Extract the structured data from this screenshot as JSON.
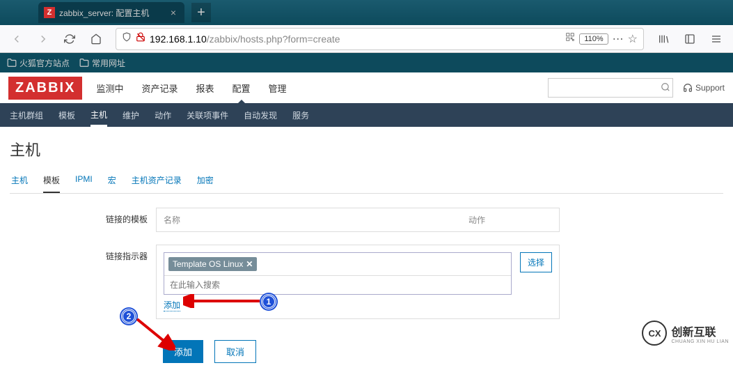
{
  "browser": {
    "tab": {
      "favicon_letter": "Z",
      "title": "zabbix_server: 配置主机"
    },
    "url": {
      "host": "192.168.1.10",
      "path": "/zabbix/hosts.php?form=create"
    },
    "zoom": "110%",
    "bookmarks": [
      {
        "label": "火狐官方站点"
      },
      {
        "label": "常用网址"
      }
    ]
  },
  "app": {
    "logo": "ZABBIX",
    "support_label": "Support",
    "main_nav": [
      {
        "label": "监测中",
        "active": false
      },
      {
        "label": "资产记录",
        "active": false
      },
      {
        "label": "报表",
        "active": false
      },
      {
        "label": "配置",
        "active": true
      },
      {
        "label": "管理",
        "active": false
      }
    ],
    "sub_nav": [
      {
        "label": "主机群组",
        "active": false
      },
      {
        "label": "模板",
        "active": false
      },
      {
        "label": "主机",
        "active": true
      },
      {
        "label": "维护",
        "active": false
      },
      {
        "label": "动作",
        "active": false
      },
      {
        "label": "关联项事件",
        "active": false
      },
      {
        "label": "自动发现",
        "active": false
      },
      {
        "label": "服务",
        "active": false
      }
    ],
    "page_title": "主机",
    "host_tabs": [
      {
        "label": "主机",
        "active": false
      },
      {
        "label": "模板",
        "active": true
      },
      {
        "label": "IPMI",
        "active": false
      },
      {
        "label": "宏",
        "active": false
      },
      {
        "label": "主机资产记录",
        "active": false
      },
      {
        "label": "加密",
        "active": false
      }
    ],
    "form": {
      "linked_label": "链接的模板",
      "linked_cols": {
        "name": "名称",
        "action": "动作"
      },
      "indicator_label": "链接指示器",
      "selected_template": "Template OS Linux",
      "search_placeholder": "在此输入搜索",
      "select_btn": "选择",
      "add_link": "添加",
      "submit": "添加",
      "cancel": "取消"
    }
  },
  "annotations": {
    "num1": "1",
    "num2": "2"
  },
  "watermark": {
    "logo": "CX",
    "text": "创新互联",
    "sub": "CHUANG XIN HU LIAN"
  }
}
